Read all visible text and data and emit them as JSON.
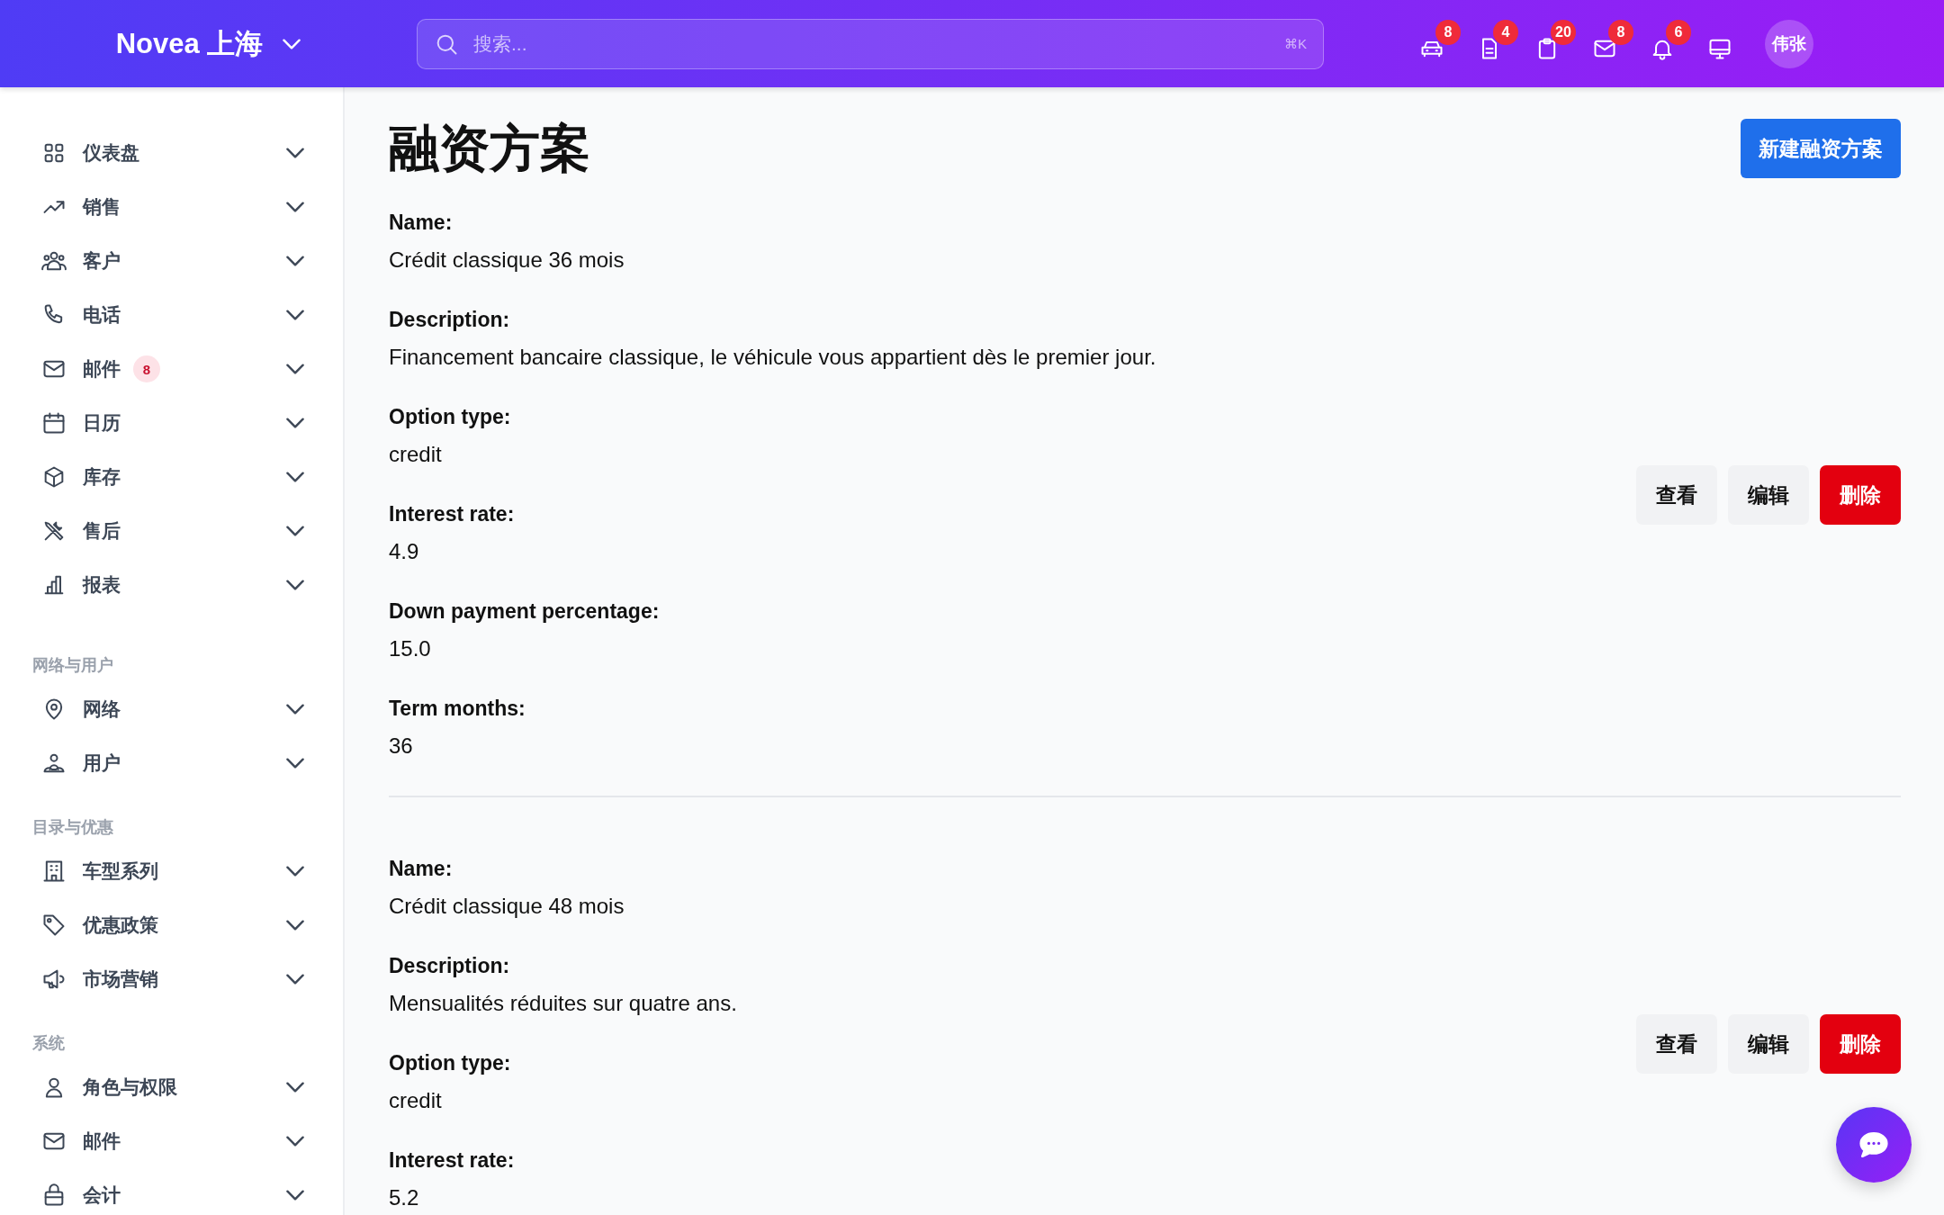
{
  "header": {
    "brand": "Novea 上海",
    "search": {
      "placeholder": "搜索...",
      "shortcut": "⌘K"
    },
    "icon_badges": [
      "8",
      "4",
      "20",
      "8",
      "6"
    ],
    "avatar": "伟张"
  },
  "sidebar": {
    "sections": [
      {
        "items": [
          {
            "label": "仪表盘"
          },
          {
            "label": "销售"
          },
          {
            "label": "客户"
          },
          {
            "label": "电话"
          },
          {
            "label": "邮件",
            "badge": "8"
          },
          {
            "label": "日历"
          },
          {
            "label": "库存"
          },
          {
            "label": "售后"
          },
          {
            "label": "报表"
          }
        ]
      },
      {
        "title": "网络与用户",
        "items": [
          {
            "label": "网络"
          },
          {
            "label": "用户"
          }
        ]
      },
      {
        "title": "目录与优惠",
        "items": [
          {
            "label": "车型系列"
          },
          {
            "label": "优惠政策"
          },
          {
            "label": "市场营销"
          }
        ]
      },
      {
        "title": "系统",
        "items": [
          {
            "label": "角色与权限"
          },
          {
            "label": "邮件"
          },
          {
            "label": "会计"
          }
        ]
      }
    ]
  },
  "page": {
    "title": "融资方案",
    "new_button": "新建融资方案",
    "records": [
      {
        "fields": [
          {
            "label": "Name:",
            "value": "Crédit classique 36 mois"
          },
          {
            "label": "Description:",
            "value": "Financement bancaire classique, le véhicule vous appartient dès le premier jour."
          },
          {
            "label": "Option type:",
            "value": "credit"
          },
          {
            "label": "Interest rate:",
            "value": "4.9"
          },
          {
            "label": "Down payment percentage:",
            "value": "15.0"
          },
          {
            "label": "Term months:",
            "value": "36"
          }
        ],
        "actions": [
          {
            "kind": "plain",
            "label": "查看"
          },
          {
            "kind": "plain",
            "label": "编辑"
          },
          {
            "kind": "danger",
            "label": "删除"
          }
        ]
      },
      {
        "fields": [
          {
            "label": "Name:",
            "value": "Crédit classique 48 mois"
          },
          {
            "label": "Description:",
            "value": "Mensualités réduites sur quatre ans."
          },
          {
            "label": "Option type:",
            "value": "credit"
          },
          {
            "label": "Interest rate:",
            "value": "5.2"
          }
        ],
        "actions": [
          {
            "kind": "plain",
            "label": "查看"
          },
          {
            "kind": "plain",
            "label": "编辑"
          },
          {
            "kind": "danger",
            "label": "删除"
          }
        ]
      }
    ]
  }
}
